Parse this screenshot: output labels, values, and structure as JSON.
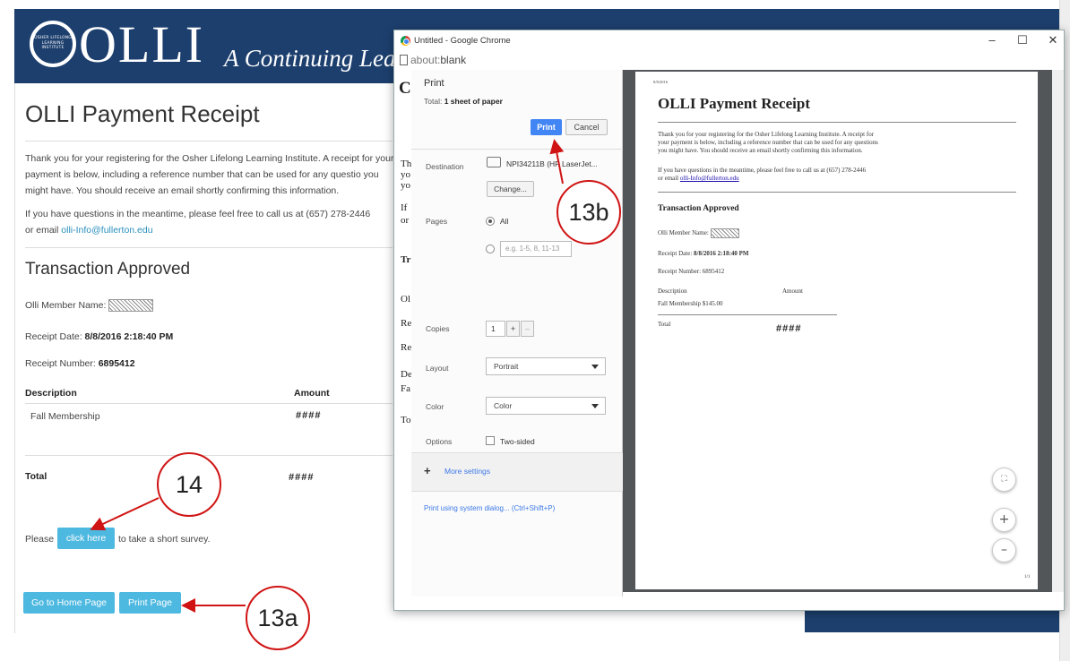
{
  "olli": {
    "logo_text": "OLLI",
    "logo_seal": "OSHER LIFELONG LEARNING INSTITUTE",
    "tagline": "A Continuing Lea",
    "title": "OLLI Payment Receipt",
    "intro_1": "Thank you for your registering for the Osher Lifelong Learning Institute. A receipt for your payment is below, including a reference number that can be used for any questio",
    "intro_2": "you might have. You should receive an email shortly confirming this information.",
    "contact_prefix": "If you have questions in the meantime, please feel free to call us at (657) 278-2446",
    "contact_or": "or email ",
    "contact_email": "olli-Info@fullerton.edu",
    "section_title": "Transaction Approved",
    "member_label": "Olli Member Name:",
    "receipt_date_label": "Receipt Date: ",
    "receipt_date_value": "8/8/2016 2:18:40 PM",
    "receipt_number_label": "Receipt Number: ",
    "receipt_number_value": "6895412",
    "col_description": "Description",
    "col_amount": "Amount",
    "row_description": "Fall Membership",
    "row_amount": "####",
    "total_label": "Total",
    "total_amount": "####",
    "survey_prefix": "Please",
    "survey_button": "click here",
    "survey_suffix": "to take a short survey.",
    "home_button": "Go to Home Page",
    "print_button": "Print Page"
  },
  "chrome": {
    "window_title": "Untitled - Google Chrome",
    "url_dim": "about:",
    "url_main": "blank",
    "min": "–",
    "max": "☐",
    "close": "✕",
    "behind_letters": [
      "C",
      "Th",
      "yo",
      "yo",
      "If",
      "or",
      "Tr",
      "Ol",
      "Re",
      "Re",
      "De",
      "Fa",
      "To"
    ]
  },
  "print_panel": {
    "title": "Print",
    "total_prefix": "Total: ",
    "total_value": "1 sheet of paper",
    "print_button": "Print",
    "cancel_button": "Cancel",
    "destination_label": "Destination",
    "destination_value": "NPI34211B (HP LaserJet...",
    "change_button": "Change...",
    "pages_label": "Pages",
    "pages_all": "All",
    "pages_placeholder": "e.g. 1-5, 8, 11-13",
    "copies_label": "Copies",
    "copies_value": "1",
    "copies_plus": "+",
    "copies_minus": "–",
    "layout_label": "Layout",
    "layout_value": "Portrait",
    "color_label": "Color",
    "color_value": "Color",
    "options_label": "Options",
    "two_sided": "Two-sided",
    "more_settings": "More settings",
    "system_dialog": "Print using system dialog... (Ctrl+Shift+P)"
  },
  "preview": {
    "date": "8/8/2016",
    "title": "OLLI Payment Receipt",
    "intro_1": "Thank you for your registering for the Osher Lifelong Learning Institute. A receipt for",
    "intro_2": "your payment is below, including a reference number that can be used for any questions",
    "intro_3": "you might have. You should receive an email shortly confirming this information.",
    "contact_1": "If you have questions in the meantime, please feel free to call us at (657) 278-2446",
    "contact_or": "or email ",
    "contact_email": "olli-Info@fullerton.edu",
    "section_title": "Transaction Approved",
    "member_label": "Olli Member Name:",
    "receipt_date_label": "Receipt Date: ",
    "receipt_date_value": "8/8/2016 2:18:40 PM",
    "receipt_number": "Receipt Number: 6895412",
    "col_description": "Description",
    "col_amount": "Amount",
    "row": "Fall Membership $145.00",
    "total_label": "Total",
    "total_amount": "####",
    "page_num": "1/1",
    "zoom_in": "+",
    "zoom_out": "–"
  },
  "callouts": {
    "c13a": "13a",
    "c13b": "13b",
    "c14": "14"
  },
  "colors": {
    "header_navy": "#1d3f6e",
    "button_blue": "#4db8e0",
    "chrome_print_blue": "#4285f4",
    "callout_red": "#d01414"
  }
}
